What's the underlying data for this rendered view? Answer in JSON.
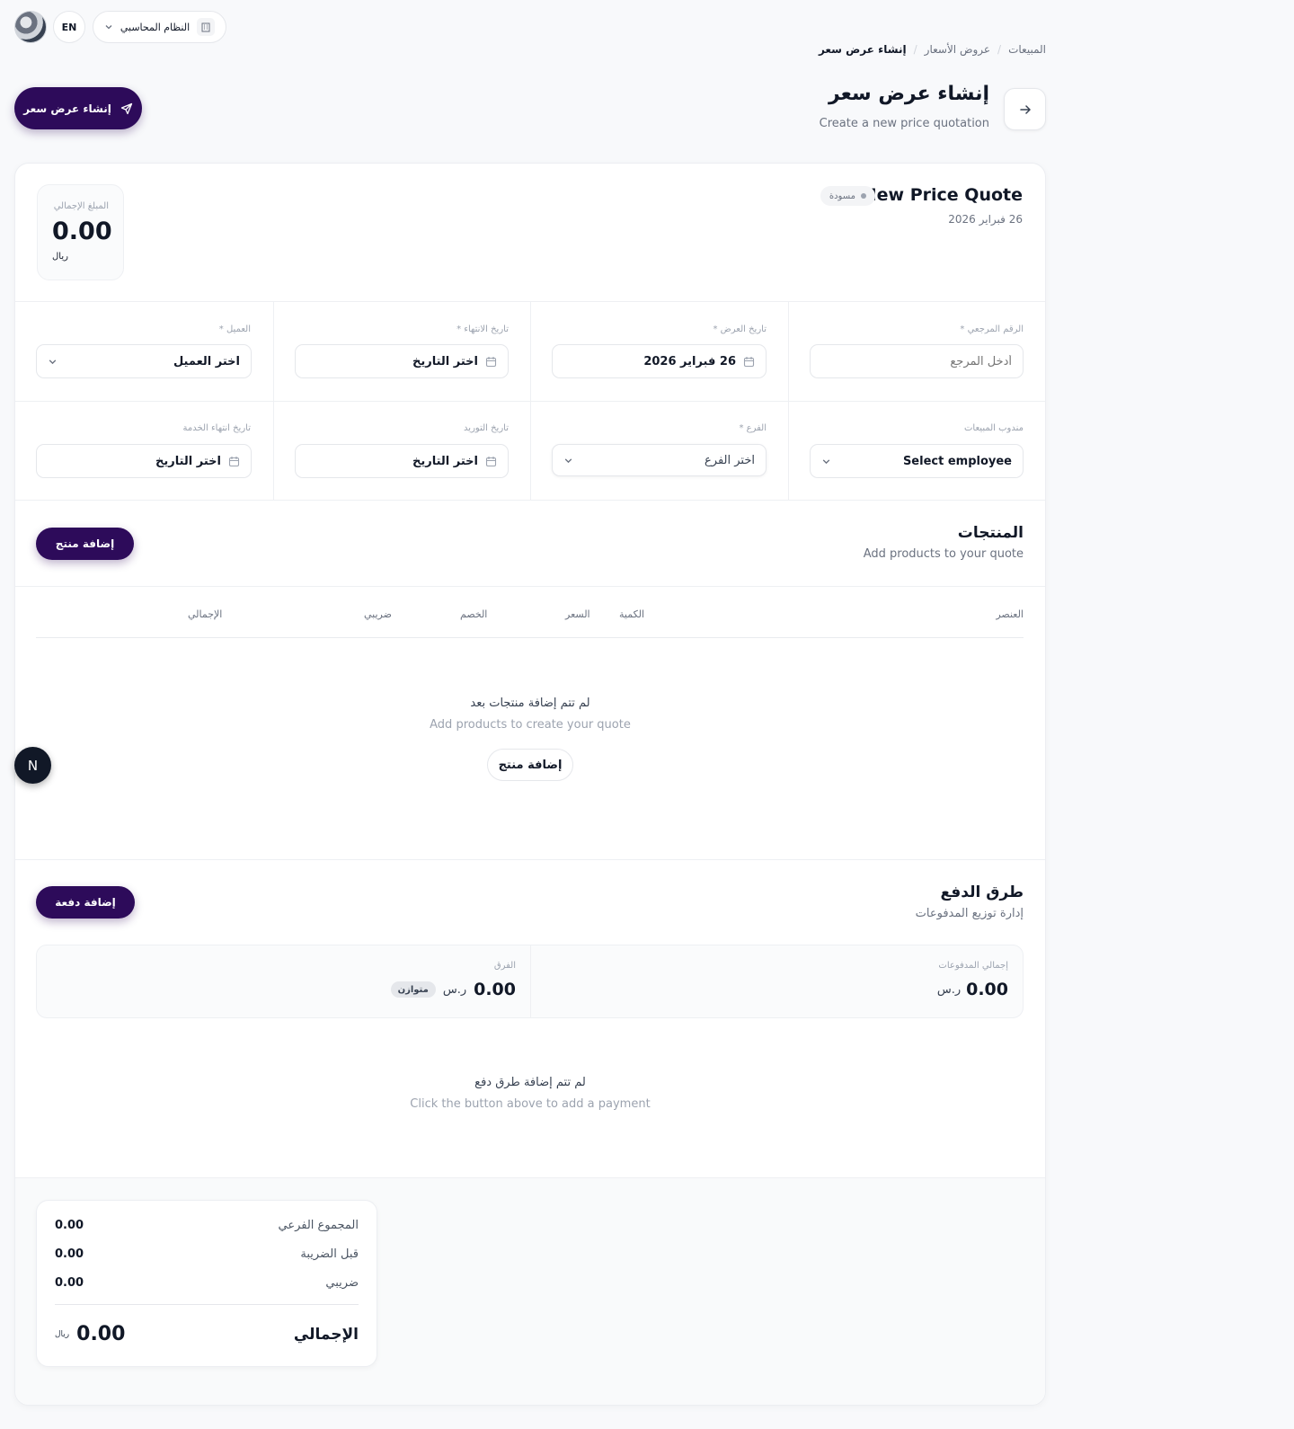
{
  "topbar": {
    "language": "EN",
    "system_selector": "النظام المحاسبي"
  },
  "breadcrumb": [
    "المبيعات",
    "عروض الأسعار",
    "إنشاء عرض سعر"
  ],
  "header": {
    "title": "إنشاء عرض سعر",
    "subtitle": "Create a new price quotation",
    "create_button": "إنشاء عرض سعر"
  },
  "quote": {
    "title": "New Price Quote",
    "status": "مسودة",
    "date": "26 فبراير 2026",
    "total_label": "المبلغ الإجمالي",
    "total_value": "0.00",
    "total_currency": "ريال"
  },
  "form": {
    "reference": {
      "label": "الرقم المرجعي *",
      "placeholder": "أدخل المرجع"
    },
    "quote_date": {
      "label": "تاريخ العرض *",
      "value": "26 فبراير 2026"
    },
    "expiry_date": {
      "label": "تاريخ الانتهاء *",
      "value": "اختر التاريخ"
    },
    "customer": {
      "label": "العميل *",
      "value": "اختر العميل"
    },
    "sales_rep": {
      "label": "مندوب المبيعات",
      "value": "Select employee"
    },
    "branch": {
      "label": "الفرع *",
      "value": "اختر الفرع"
    },
    "supply_date": {
      "label": "تاريخ التوريد",
      "value": "اختر التاريخ"
    },
    "service_end_date": {
      "label": "تاريخ انتهاء الخدمة",
      "value": "اختر التاريخ"
    }
  },
  "products": {
    "title": "المنتجات",
    "subtitle": "Add products to your quote",
    "add_button": "إضافة منتج",
    "columns": {
      "item": "العنصر",
      "qty": "الكمية",
      "price": "السعر",
      "discount": "الخصم",
      "tax": "ضريبي",
      "total": "الإجمالي"
    },
    "empty_title": "لم تتم إضافة منتجات بعد",
    "empty_sub": "Add products to create your quote",
    "empty_button": "إضافة منتج"
  },
  "floating_badge": "N",
  "payments": {
    "title": "طرق الدفع",
    "subtitle": "إدارة توزيع المدفوعات",
    "add_button": "إضافة دفعة",
    "total_paid_label": "إجمالي المدفوعات",
    "total_paid_value": "0.00",
    "total_paid_currency": "ر.س",
    "diff_label": "الفرق",
    "diff_value": "0.00",
    "diff_currency": "ر.س",
    "balanced": "متوازن",
    "empty_title": "لم تتم إضافة طرق دفع",
    "empty_sub": "Click the button above to add a payment"
  },
  "summary": {
    "subtotal_label": "المجموع الفرعي",
    "subtotal": "0.00",
    "pre_tax_label": "قبل الضريبة",
    "pre_tax": "0.00",
    "tax_label": "ضريبي",
    "tax": "0.00",
    "total_label": "الإجمالي",
    "total": "0.00",
    "currency": "ريال"
  },
  "colors": {
    "primary": "#2d0b5a",
    "background": "#f8f9fb"
  }
}
